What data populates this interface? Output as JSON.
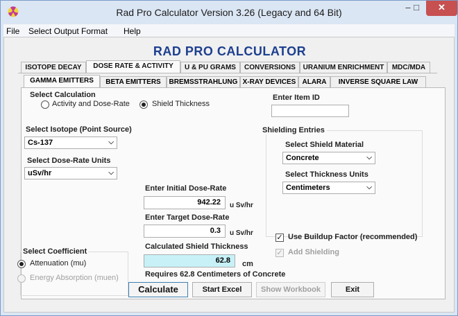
{
  "window": {
    "title": "Rad Pro Calculator Version 3.26 (Legacy and 64 Bit)",
    "controls": {
      "minimize": "–",
      "maximize": "□",
      "close": "✕"
    }
  },
  "menu": [
    "File",
    "Select Output Format",
    "Help"
  ],
  "app_title": "RAD PRO CALCULATOR",
  "main_tabs": [
    "ISOTOPE DECAY",
    "DOSE RATE & ACTIVITY",
    "U & PU GRAMS",
    "CONVERSIONS",
    "URANIUM ENRICHMENT",
    "MDC/MDA"
  ],
  "active_main_tab": "DOSE RATE & ACTIVITY",
  "sub_tabs": [
    "GAMMA EMITTERS",
    "BETA EMITTERS",
    "BREMSSTRAHLUNG",
    "X-RAY DEVICES",
    "ALARA",
    "INVERSE SQUARE LAW"
  ],
  "active_sub_tab": "GAMMA EMITTERS",
  "calculation": {
    "label": "Select  Calculation",
    "options": [
      "Activity and Dose-Rate",
      "Shield Thickness"
    ],
    "selected": "Shield Thickness"
  },
  "item_id": {
    "label": "Enter Item ID",
    "value": ""
  },
  "isotope": {
    "label": "Select Isotope (Point Source)",
    "value": "Cs-137"
  },
  "dose_units": {
    "label": "Select Dose-Rate Units",
    "value": "uSv/hr"
  },
  "shielding": {
    "group_label": "Shielding Entries",
    "material_label": "Select Shield Material",
    "material_value": "Concrete",
    "units_label": "Select Thickness Units",
    "units_value": "Centimeters"
  },
  "initial_dose": {
    "label": "Enter Initial Dose-Rate",
    "value": "942.22",
    "unit": "u Sv/hr"
  },
  "target_dose": {
    "label": "Enter Target Dose-Rate",
    "value": "0.3",
    "unit": "u Sv/hr"
  },
  "shield_result": {
    "label": "Calculated Shield Thickness",
    "value": "62.8",
    "unit": "cm",
    "note": "Requires 62.8 Centimeters of Concrete"
  },
  "buildup": {
    "label": "Use Buildup Factor (recommended)",
    "checked": true
  },
  "add_shielding": {
    "label": "Add Shielding",
    "checked": true,
    "disabled": true
  },
  "coefficient": {
    "label": "Select Coefficient",
    "options": [
      "Attenuation (mu)",
      "Energy Absorption (muen)"
    ],
    "selected": "Attenuation (mu)"
  },
  "buttons": {
    "calculate": "Calculate",
    "start_excel": "Start Excel",
    "show_workbook": "Show Workbook",
    "exit": "Exit"
  },
  "colors": {
    "app_title": "#1d3f8f",
    "close_button": "#c75050",
    "result_field": "#c7f1f7",
    "window_frame": "#dbe6f4"
  }
}
